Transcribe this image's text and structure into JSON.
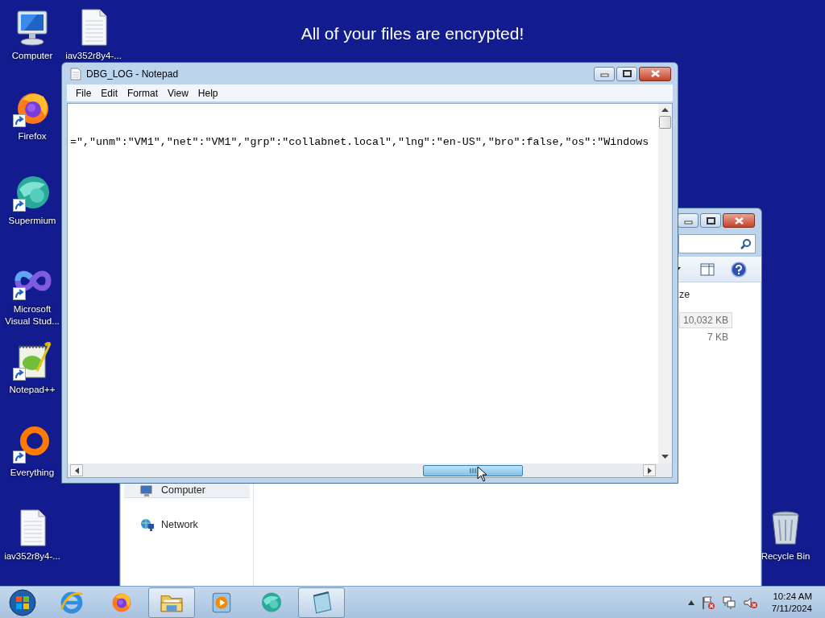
{
  "desktop": {
    "banner": "All of your files are encrypted!",
    "icons": [
      {
        "label": "Computer",
        "kind": "computer",
        "shortcut": false
      },
      {
        "label": "iav352r8y4-...",
        "kind": "document",
        "shortcut": false
      },
      {
        "label": "Firefox",
        "kind": "firefox",
        "shortcut": true
      },
      {
        "label": "Supermium",
        "kind": "supermium",
        "shortcut": true
      },
      {
        "label": "Microsoft Visual Stud...",
        "kind": "infinity",
        "shortcut": true
      },
      {
        "label": "Notepad++",
        "kind": "notepadpp",
        "shortcut": true
      },
      {
        "label": "Everything",
        "kind": "ring",
        "shortcut": true
      },
      {
        "label": "iav352r8y4-...",
        "kind": "document",
        "shortcut": false
      },
      {
        "label": "Recycle Bin",
        "kind": "recycle",
        "shortcut": false
      }
    ]
  },
  "explorer_window": {
    "column_header": "ze",
    "sizes": [
      {
        "text": "10,032 KB",
        "selected": true
      },
      {
        "text": "7 KB",
        "selected": false
      }
    ],
    "nav_items": [
      {
        "label": "Computer",
        "kind": "computer",
        "selected": true
      },
      {
        "label": "Network",
        "kind": "network",
        "selected": false
      }
    ]
  },
  "notepad": {
    "title": "DBG_LOG - Notepad",
    "menu": [
      "File",
      "Edit",
      "Format",
      "View",
      "Help"
    ],
    "text": "=\",\"unm\":\"VM1\",\"net\":\"VM1\",\"grp\":\"collabnet.local\",\"lng\":\"en-US\",\"bro\":false,\"os\":\"Windows"
  },
  "taskbar": {
    "apps": [
      {
        "kind": "ie",
        "open": false
      },
      {
        "kind": "firefox",
        "open": false
      },
      {
        "kind": "folder",
        "open": true
      },
      {
        "kind": "media",
        "open": false
      },
      {
        "kind": "supermium",
        "open": false
      },
      {
        "kind": "notepad",
        "open": true
      }
    ],
    "clock": {
      "time": "10:24 AM",
      "date": "7/11/2024"
    }
  }
}
